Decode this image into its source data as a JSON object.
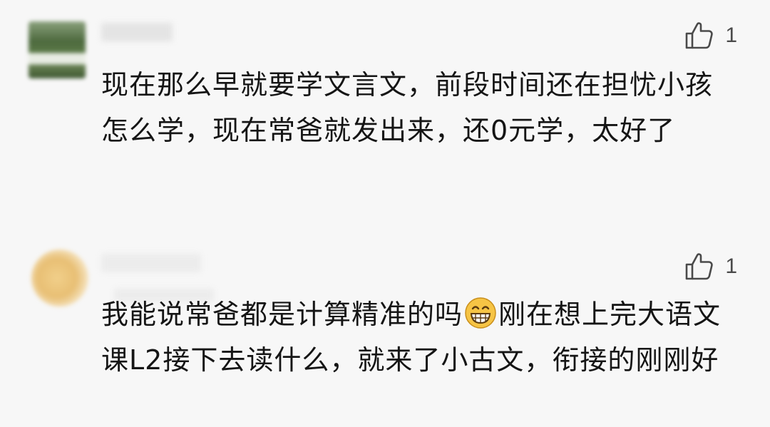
{
  "comments": [
    {
      "likes": "1",
      "text_before_emoji": "现在那么早就要学文言文，前段时间还在担忧小孩怎么学，现在常爸就发出来，还0元学，太好了",
      "emoji": "grinning-face",
      "text_after_emoji": ""
    },
    {
      "likes": "1",
      "text_before_emoji": "我能说常爸都是计算精准的吗",
      "emoji": "grinning-face",
      "text_after_emoji": "刚在想上完大语文课L2接下去读什么，就来了小古文，衔接的刚刚好"
    }
  ],
  "icons": {
    "like": "thumbs-up-outline-icon",
    "emoji": "grinning-face-emoji-icon"
  },
  "colors": {
    "background": "#f7f7f7",
    "text": "#151515",
    "like": "#4a4a4a",
    "emoji_face": "#f6c445"
  }
}
